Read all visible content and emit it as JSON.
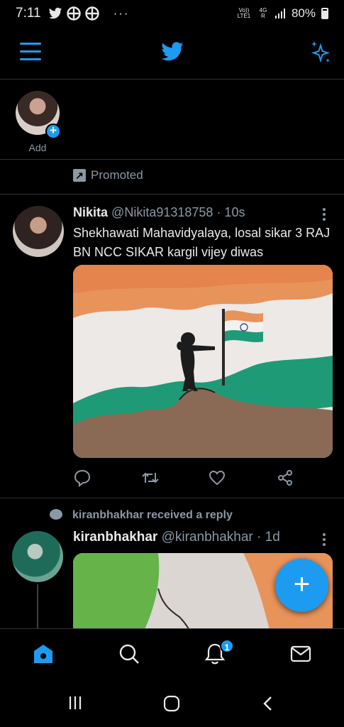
{
  "status_bar": {
    "time": "7:11",
    "network": "Vo)) LTE1",
    "signal": "4G R",
    "battery": "80%"
  },
  "fleets": {
    "add_label": "Add"
  },
  "promoted": {
    "label": "Promoted"
  },
  "tweet1": {
    "name": "Nikita",
    "handle": "@Nikita91318758",
    "time": "· 10s",
    "text": "Shekhawati Mahavidyalaya, losal sikar  3 RAJ BN NCC SIKAR kargil vijey diwas"
  },
  "tweet2": {
    "reply_note": "kiranbhakhar received a reply",
    "name": "kiranbhakhar",
    "handle": "@kiranbhakhar",
    "time": "· 1d"
  },
  "tabbar": {
    "notifications_badge": "1"
  },
  "colors": {
    "accent": "#1d9bf0",
    "background": "#000000",
    "divider": "#2f3336",
    "muted": "#8b98a5"
  }
}
